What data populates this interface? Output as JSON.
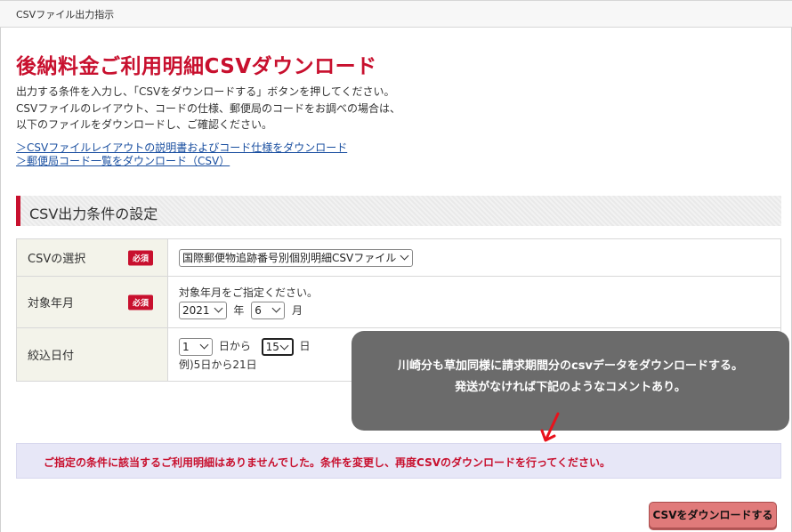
{
  "header": {
    "title": "CSVファイル出力指示"
  },
  "page": {
    "title": "後納料金ご利用明細CSVダウンロード"
  },
  "intro": {
    "line1": "出力する条件を入力し、「CSVをダウンロードする」ボタンを押してください。",
    "line2": "CSVファイルのレイアウト、コードの仕様、郵便局のコードをお調べの場合は、",
    "line3": "以下のファイルをダウンロードし、ご確認ください。"
  },
  "links": {
    "layout": "＞CSVファイルレイアウトの説明書およびコード仕様をダウンロード",
    "postcode": "＞郵便局コード一覧をダウンロード（CSV）"
  },
  "section": {
    "title": "CSV出力条件の設定"
  },
  "form": {
    "required_badge": "必須",
    "csv": {
      "label": "CSVの選択",
      "value": "国際郵便物追跡番号別個別明細CSVファイル"
    },
    "month": {
      "label": "対象年月",
      "hint": "対象年月をご指定ください。",
      "year": "2021",
      "year_unit": "年",
      "month": "6",
      "month_unit": "月"
    },
    "day": {
      "label": "絞込日付",
      "from": "1",
      "from_text": "日から",
      "to": "15",
      "to_text": "日",
      "example": "例)5日から21日"
    }
  },
  "tooltip": {
    "line1": "川崎分も草加同様に請求期間分のcsvデータをダウンロードする。",
    "line2": "発送がなければ下記のようなコメントあり。"
  },
  "notice": {
    "text": "ご指定の条件に該当するご利用明細はありませんでした。条件を変更し、再度CSVのダウンロードを行ってください。"
  },
  "download_button": {
    "label": "CSVをダウンロードする"
  },
  "colors": {
    "accent": "#c8102e",
    "link": "#1a4fa0",
    "tooltip": "#6b6b6b",
    "button": "#e07a7a"
  }
}
